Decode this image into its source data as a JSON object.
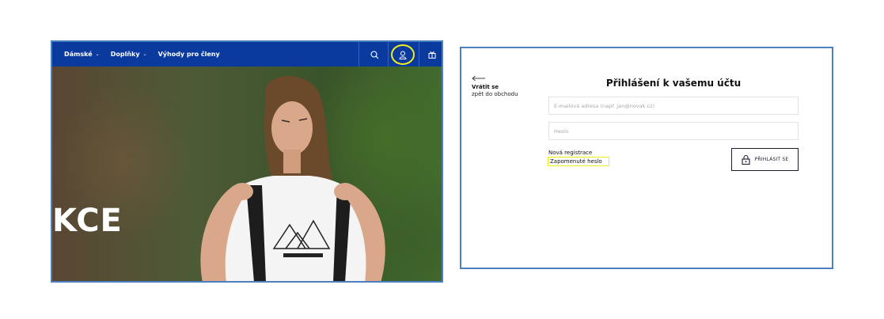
{
  "shop": {
    "nav": {
      "items": [
        {
          "label": "Dámské",
          "icon": "chevron-down-icon"
        },
        {
          "label": "Doplňky",
          "icon": "chevron-down-icon"
        },
        {
          "label": "Výhody pro členy"
        }
      ],
      "icons": [
        "search-icon",
        "user-icon",
        "gift-icon"
      ],
      "highlight_color": "#f0ec1c",
      "bar_color": "#0a3a9e"
    },
    "hero": {
      "text": "KCE"
    }
  },
  "login": {
    "back": {
      "title": "Vrátit se",
      "subtitle": "zpět do obchodu",
      "icon": "arrow-left-icon"
    },
    "title": "Přihlášení k vašemu účtu",
    "email": {
      "placeholder": "E-mailová adresa (např. jan@novak.cz)",
      "value": ""
    },
    "password": {
      "placeholder": "Heslo",
      "value": ""
    },
    "register_link": "Nová registrace",
    "forgot_link": "Zapomenuté heslo",
    "submit": {
      "label": "PŘIHLÁSIT SE",
      "icon": "lock-icon"
    }
  }
}
